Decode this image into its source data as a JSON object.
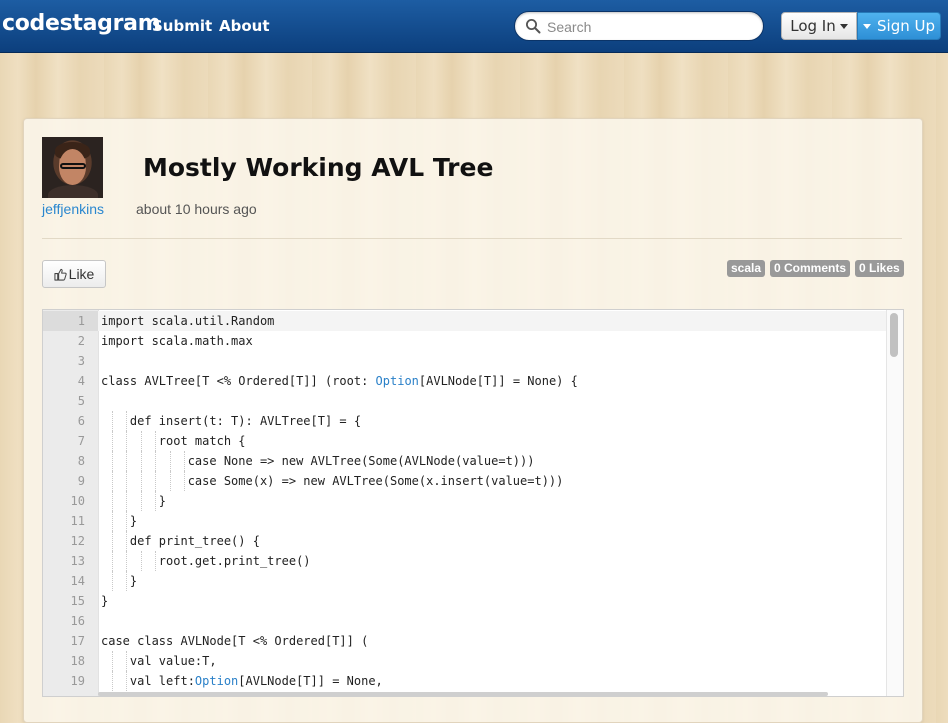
{
  "navbar": {
    "brand": "codestagram",
    "links": [
      "Submit",
      "About"
    ],
    "search_placeholder": "Search",
    "login_label": "Log In",
    "signup_label": "Sign Up"
  },
  "post": {
    "title": "Mostly Working AVL Tree",
    "author": "jeffjenkins",
    "timestamp": "about 10 hours ago",
    "like_label": "Like",
    "tag": "scala",
    "comments_badge": "0 Comments",
    "likes_badge": "0 Likes"
  },
  "code": {
    "lines": [
      "import scala.util.Random",
      "import scala.math.max",
      "",
      "class AVLTree[T <% Ordered[T]] (root: Option[AVLNode[T]] = None) {",
      "",
      "    def insert(t: T): AVLTree[T] = {",
      "        root match {",
      "            case None => new AVLTree(Some(AVLNode(value=t)))",
      "            case Some(x) => new AVLTree(Some(x.insert(value=t)))",
      "        }",
      "    }",
      "    def print_tree() {",
      "        root.get.print_tree()",
      "    }",
      "}",
      "",
      "case class AVLNode[T <% Ordered[T]] (",
      "    val value:T,",
      "    val left:Option[AVLNode[T]] = None,"
    ],
    "line_numbers": [
      "1",
      "2",
      "3",
      "4",
      "5",
      "6",
      "7",
      "8",
      "9",
      "10",
      "11",
      "12",
      "13",
      "14",
      "15",
      "16",
      "17",
      "18",
      "19"
    ],
    "highlight_word": "Option",
    "highlight_color": "#2a80c8",
    "active_line": 1
  },
  "colors": {
    "navbar": "#0c3f7d",
    "link": "#2a87cf",
    "signup": "#2e8fd6",
    "badge": "#999999"
  }
}
